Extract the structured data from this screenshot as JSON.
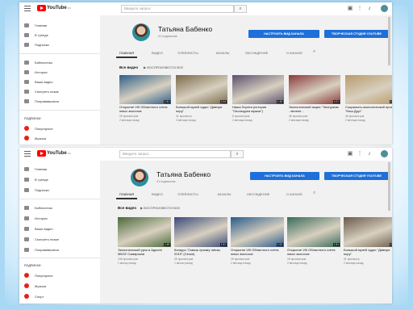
{
  "shots": [
    {
      "topbar": {
        "logo": "YouTube",
        "logo_region": "RU",
        "search_placeholder": "Введите запрос"
      },
      "sidebar": {
        "items": [
          "Главная",
          "В тренде",
          "Подписки",
          "Библиотека",
          "История",
          "Ваши видео",
          "Смотреть позже",
          "Понравившиеся"
        ],
        "subs_heading": "ПОДПИСКИ",
        "subs": [
          "Популярное",
          "Музыка"
        ]
      },
      "channel": {
        "name": "Татьяна Бабенко",
        "subscribers": "41 подписчик",
        "customize_button": "НАСТРОИТЬ ВИД КАНАЛА",
        "studio_button": "ТВОРЧЕСКАЯ СТУДИЯ YOUTUBE"
      },
      "tabs": [
        "ГЛАВНАЯ",
        "ВИДЕО",
        "ПЛЕЙЛИСТЫ",
        "КАНАЛЫ",
        "ОБСУЖДЕНИЕ",
        "О КАНАЛЕ"
      ],
      "section": {
        "title": "Все видео",
        "play_all": "ВОСПРОИЗВЕСТИ ВСЕ"
      },
      "videos": [
        {
          "title": "Открытие VIII Областного слета юных экологов",
          "views": "26 просмотров",
          "age": "2 месяца назад",
          "duration": "1:51",
          "color": "#2f5f8a"
        },
        {
          "title": "Большой музей чудес \"Дивную пору\"",
          "views": "41 просмотр",
          "age": "2 месяца назад",
          "duration": "2:44",
          "color": "#7a6a4a"
        },
        {
          "title": "Наша Лорета (история \"Окольцуем мушки\")",
          "views": "8 просмотров",
          "age": "2 месяца назад",
          "duration": "1:33",
          "color": "#5a4f6e"
        },
        {
          "title": "Экологический акция \"Экотуризм - веселе...",
          "views": "46 просмотров",
          "age": "2 месяца назад",
          "duration": "4:21",
          "color": "#8a3a3a"
        },
        {
          "title": "Социально-экологический проект \"Наш Друг\"",
          "views": "48 просмотров",
          "age": "2 месяца назад",
          "duration": "1:52",
          "color": "#b89a6a"
        }
      ]
    },
    {
      "topbar": {
        "logo": "YouTube",
        "logo_region": "RU",
        "search_placeholder": "Введите запрос"
      },
      "sidebar": {
        "items": [
          "Главная",
          "В тренде",
          "Подписки",
          "Библиотека",
          "История",
          "Ваши видео",
          "Смотреть позже",
          "Понравившиеся"
        ],
        "subs_heading": "ПОДПИСКИ",
        "subs": [
          "Популярное",
          "Музыка",
          "Спорт"
        ]
      },
      "channel": {
        "name": "Татьяна Бабенко",
        "subscribers": "41 подписчик",
        "customize_button": "НАСТРОИТЬ ВИД КАНАЛА",
        "studio_button": "ТВОРЧЕСКАЯ СТУДИЯ YOUTUBE"
      },
      "tabs": [
        "ГЛАВНАЯ",
        "ВИДЕО",
        "ПЛЕЙЛИСТЫ",
        "КАНАЛЫ",
        "ОБСУЖДЕНИЕ",
        "О КАНАЛЕ"
      ],
      "section": {
        "title": "Все видео",
        "play_all": "ВОСПРОИЗВЕСТИ ВСЕ"
      },
      "videos": [
        {
          "title": "Экологический урок в Адыгее МКОУ Самарская",
          "views": "106 просмотров",
          "age": "1 месяц назад",
          "duration": "1:49",
          "color": "#4a6a3a"
        },
        {
          "title": "Конкурс \"Сквозь призму линзы 2019\" (Сезон)",
          "views": "39 просмотров",
          "age": "1 месяц назад",
          "duration": "1:51",
          "color": "#3a4a7a"
        },
        {
          "title": "Открытие VIII Областного слета юных экологов",
          "views": "26 просмотров",
          "age": "2 месяца назад",
          "duration": "1:51",
          "color": "#2a5a8a"
        },
        {
          "title": "Открытие VIII Областного слета юных экологов",
          "views": "18 просмотров",
          "age": "2 месяца назад",
          "duration": "1:51",
          "color": "#3a6a5a"
        },
        {
          "title": "Большой музей чудес \"Дивную пору\"",
          "views": "41 просмотр",
          "age": "2 месяца назад",
          "duration": "2:44",
          "color": "#6a5a4a"
        }
      ]
    }
  ]
}
